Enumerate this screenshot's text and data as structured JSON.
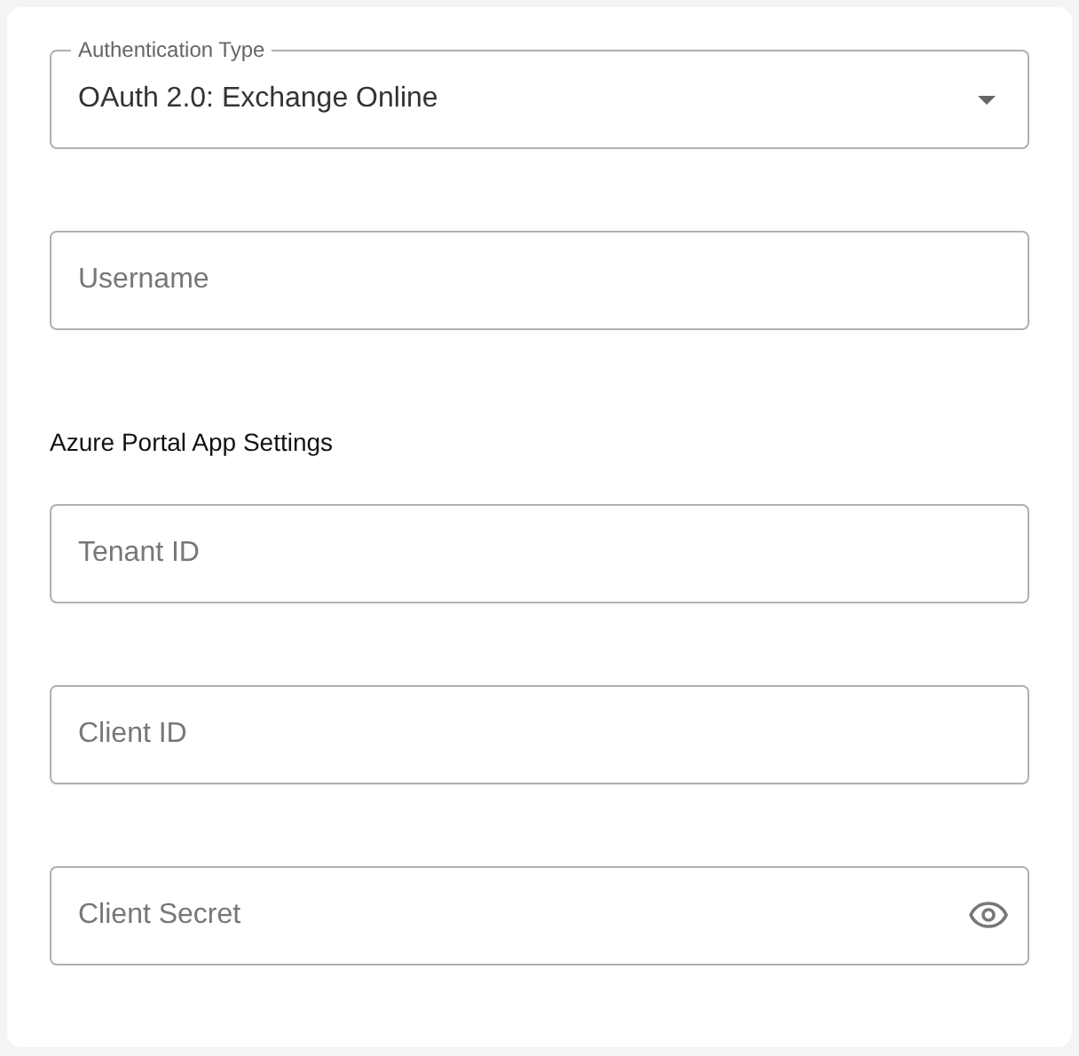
{
  "auth_type": {
    "label": "Authentication Type",
    "value": "OAuth 2.0: Exchange Online"
  },
  "fields": [
    {
      "placeholder": "Username"
    }
  ],
  "section": {
    "heading": "Azure Portal App Settings",
    "fields": [
      {
        "placeholder": "Tenant ID"
      },
      {
        "placeholder": "Client ID"
      },
      {
        "placeholder": "Client Secret",
        "visibility_toggle": true
      }
    ]
  }
}
